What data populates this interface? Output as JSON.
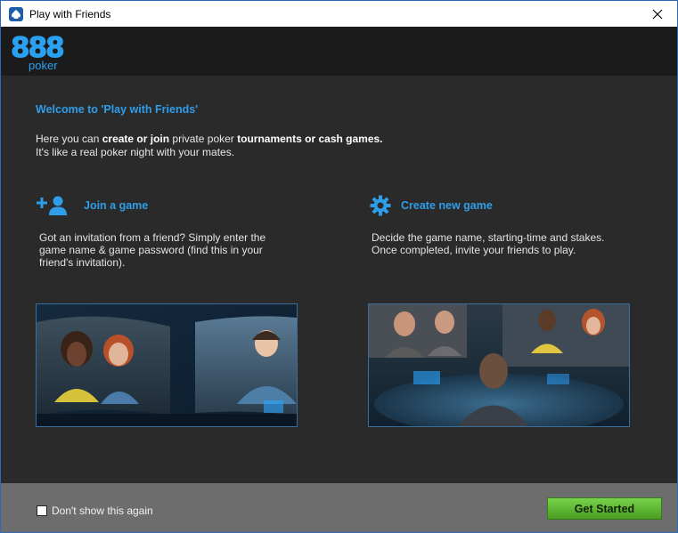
{
  "window": {
    "title": "Play with Friends"
  },
  "logo": {
    "digits": "888",
    "word": "poker"
  },
  "welcome": {
    "heading": "Welcome to 'Play with Friends'"
  },
  "intro": {
    "line1_pre": "Here you can ",
    "line1_bold1": "create or join",
    "line1_mid": " private poker ",
    "line1_bold2": "tournaments or cash games.",
    "line2": "It's like a real poker night with your mates."
  },
  "join": {
    "icon": "add-user-icon",
    "title": "Join a game",
    "desc_lines": [
      "Got an invitation from a friend? Simply enter the",
      "game name & game password (find this in your",
      "friend's invitation)."
    ]
  },
  "create": {
    "icon": "gear-icon",
    "title": "Create new game",
    "desc_lines": [
      "Decide the game name, starting-time and stakes.",
      "Once completed, invite your friends to play."
    ]
  },
  "footer": {
    "checkbox_label": "Don't show this again",
    "checkbox_checked": false,
    "start_button": "Get Started"
  },
  "colors": {
    "accent": "#2f9de8",
    "button": "#5cb82e",
    "header": "#1b1b1b",
    "body": "#2a2a2a",
    "footer": "#6d6d6d"
  }
}
